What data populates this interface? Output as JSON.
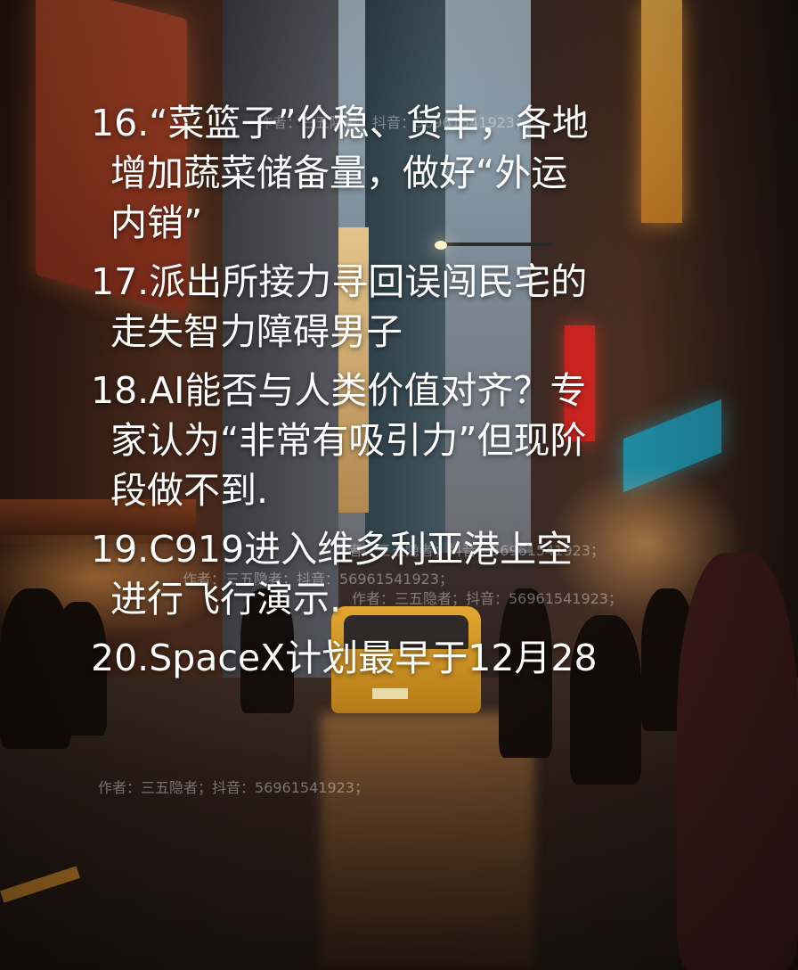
{
  "watermark": {
    "text": "作者：三五隐者；抖音：56961541923；"
  },
  "news_items": [
    {
      "number": "16.",
      "lines": [
        "“菜篮子”价稳、货丰，各地",
        "增加蔬菜储备量，做好“外运",
        "内销”"
      ]
    },
    {
      "number": "17.",
      "lines": [
        "派出所接力寻回误闯民宅的",
        "走失智力障碍男子"
      ]
    },
    {
      "number": "18.",
      "lines": [
        "AI能否与人类价值对齐？专",
        "家认为“非常有吸引力”但现阶",
        "段做不到."
      ]
    },
    {
      "number": "19.",
      "lines": [
        "C919进入维多利亚港上空",
        "进行飞行演示."
      ]
    },
    {
      "number": "20.",
      "lines": [
        "SpaceX计划最早于12月28"
      ]
    }
  ]
}
